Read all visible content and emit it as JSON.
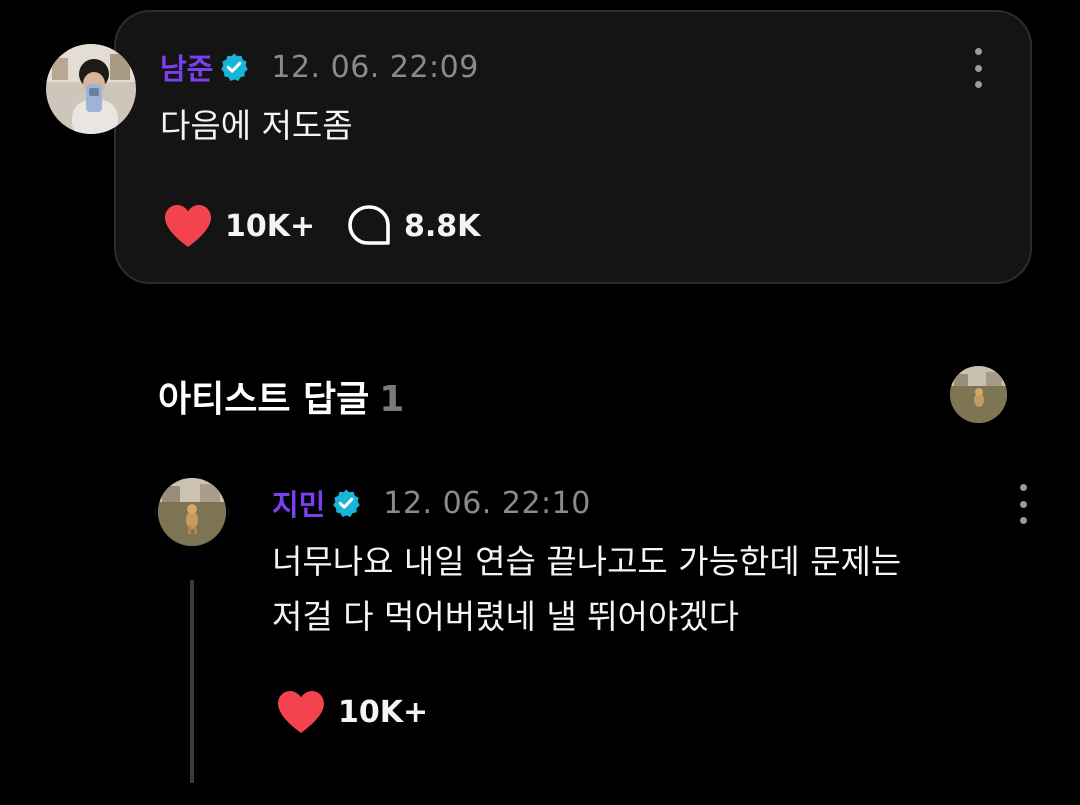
{
  "post": {
    "author": "남준",
    "timestamp": "12. 06. 22:09",
    "message": "다음에 저도좀",
    "likes": "10K+",
    "comments": "8.8K"
  },
  "artist_replies": {
    "title": "아티스트 답글",
    "count": "1"
  },
  "reply": {
    "author": "지민",
    "timestamp": "12. 06. 22:10",
    "message_lines": [
      "너무나요 내일 연습 끝나고도 가능한데 문제는",
      "저걸 다 먹어버렸네 낼 뛰어야겠다"
    ],
    "likes": "10K+"
  },
  "colors": {
    "background": "#000000",
    "card": "#141414",
    "author_name": "#7b3ff2",
    "verified_badge": "#19b5d6",
    "timestamp": "#8a8a8e",
    "heart": "#f3434e"
  },
  "icons": {
    "verified": "verified-badge-icon",
    "like": "heart-icon",
    "comment": "speech-bubble-icon",
    "menu": "vertical-ellipsis-icon"
  }
}
